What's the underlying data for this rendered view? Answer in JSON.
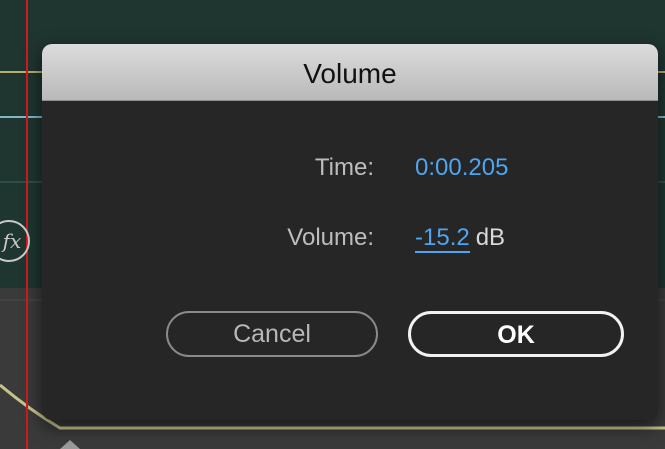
{
  "dialog": {
    "title": "Volume",
    "time_label": "Time:",
    "time_value": "0:00.205",
    "volume_label": "Volume:",
    "volume_value": "-15.2",
    "volume_unit": "dB",
    "cancel_label": "Cancel",
    "ok_label": "OK"
  },
  "background": {
    "fx_label": "fx"
  },
  "colors": {
    "accent": "#4ea5f0",
    "playhead": "#d11a1a",
    "track": "#1f3530"
  }
}
